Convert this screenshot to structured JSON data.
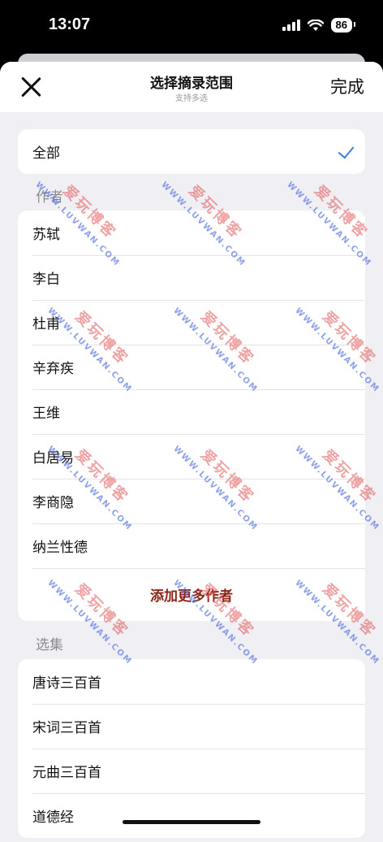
{
  "status_bar": {
    "time": "13:07",
    "battery": "86"
  },
  "header": {
    "title": "选择摘录范围",
    "subtitle": "支持多选",
    "done_label": "完成"
  },
  "all_option": {
    "label": "全部",
    "selected": true
  },
  "authors": {
    "section_label": "作者",
    "items": [
      "苏轼",
      "李白",
      "杜甫",
      "辛弃疾",
      "王维",
      "白居易",
      "李商隐",
      "纳兰性德"
    ],
    "add_more_label": "添加更多作者"
  },
  "collections": {
    "section_label": "选集",
    "items": [
      "唐诗三百首",
      "宋词三百首",
      "元曲三百首",
      "道德经"
    ]
  },
  "watermark": {
    "text_cn": "爱玩博客",
    "text_en": "WWW.LUVWAN.COM"
  },
  "colors": {
    "accent": "#3d7bdc",
    "add_more": "#8a2517",
    "background": "#f0eff4"
  }
}
